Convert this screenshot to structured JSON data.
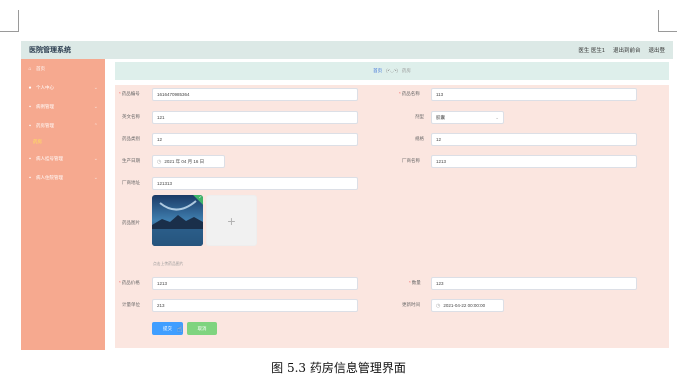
{
  "app": {
    "title": "医院管理系统"
  },
  "topbar": {
    "user": "医生 医生1",
    "exit_frontend": "退出到前台",
    "logout": "退出登"
  },
  "sidebar": {
    "items": [
      {
        "label": "首页",
        "icon": "home-icon"
      },
      {
        "label": "个人中心",
        "icon": "user-icon"
      },
      {
        "label": "病例管理",
        "icon": "folder-icon"
      },
      {
        "label": "药房管理",
        "icon": "folder-icon"
      },
      {
        "label": "药房",
        "sub": true
      },
      {
        "label": "病人挂号管理",
        "icon": "folder-icon"
      },
      {
        "label": "病人住院管理",
        "icon": "folder-icon"
      }
    ]
  },
  "breadcrumb": {
    "home": "首页",
    "separator": "(•'◡'•)",
    "current": "药房"
  },
  "form": {
    "drug_code": {
      "label": "药品编号",
      "value": "1616470985364",
      "required": true
    },
    "drug_name": {
      "label": "药品名称",
      "value": "113",
      "required": true
    },
    "english_name": {
      "label": "英文名称",
      "value": "121"
    },
    "dosage_form": {
      "label": "剂型",
      "value": "胶囊"
    },
    "drug_category": {
      "label": "药品类别",
      "value": "12"
    },
    "specification": {
      "label": "规格",
      "value": "12"
    },
    "production_date": {
      "label": "生产日期",
      "value": "2021 年 04 月 16 日"
    },
    "manufacturer": {
      "label": "厂商名称",
      "value": "1213"
    },
    "manufacturer_address": {
      "label": "厂商地址",
      "value": "121313"
    },
    "drug_image": {
      "label": "药品图片",
      "hint": "点击上传药品图片"
    },
    "price": {
      "label": "药品价格",
      "value": "1213",
      "required": true
    },
    "quantity": {
      "label": "数量",
      "value": "123",
      "required": true
    },
    "unit": {
      "label": "计量单位",
      "value": "213"
    },
    "updated_at": {
      "label": "更新时间",
      "value": "2021-04-22 00:00:00"
    },
    "submit_label": "提交",
    "cancel_label": "取消"
  },
  "caption": "图 5.3  药房信息管理界面",
  "colors": {
    "sidebar_bg": "#f6a98f",
    "topbar_bg": "#dce9e6",
    "form_bg": "#fbe6e0",
    "primary": "#409eff",
    "cancel": "#7fd47f",
    "submenu_active": "#ffe45a"
  }
}
